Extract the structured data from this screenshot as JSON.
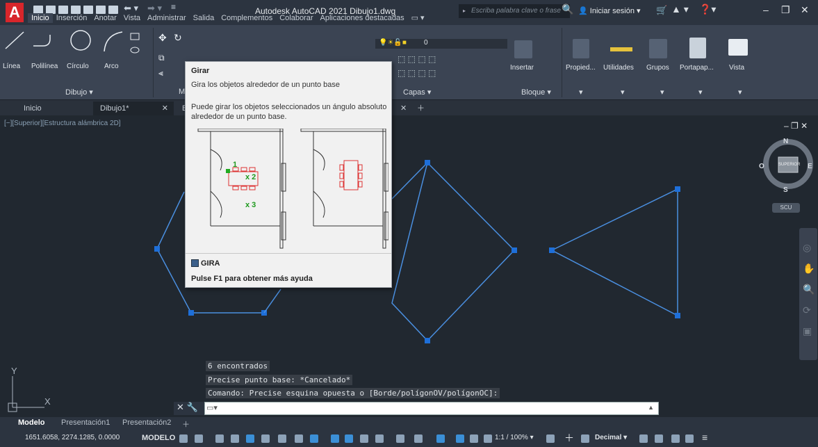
{
  "window": {
    "title": "Autodesk AutoCAD 2021   Dibujo1.dwg",
    "search_placeholder": "Escriba palabra clave o frase",
    "login": "Iniciar sesión",
    "logo": "A"
  },
  "ribbon_tabs": [
    "Inicio",
    "Inserción",
    "Anotar",
    "Vista",
    "Administrar",
    "Salida",
    "Complementos",
    "Colaborar",
    "Aplicaciones destacadas"
  ],
  "ribbon": {
    "draw_tools": [
      "Línea",
      "Polilínea",
      "Círculo",
      "Arco"
    ],
    "draw_panel": "Dibujo",
    "modify_panel_partial": "M",
    "layers_panel": "Capas",
    "layer_value": "0",
    "insert_label": "Insertar",
    "block_panel": "Bloque",
    "big_tools": [
      "Propied...",
      "Utilidades",
      "Grupos",
      "Portapap...",
      "Vista"
    ]
  },
  "file_tabs": [
    "Inicio",
    "Dibujo1*"
  ],
  "file_tab_partial": "B",
  "viewport": {
    "label": "[−][Superior][Estructura alámbrica 2D]",
    "compass": {
      "n": "N",
      "s": "S",
      "e": "E",
      "o": "O",
      "center": "SUPERIOR",
      "scu": "SCU"
    }
  },
  "tooltip": {
    "title": "Girar",
    "desc": "Gira los objetos alrededor de un punto base",
    "long": "Puede girar los objetos seleccionados un ángulo absoluto alrededor de un punto base.",
    "marks": [
      "1",
      "x 2",
      "x 3"
    ],
    "command": "GIRA",
    "help": "Pulse F1 para obtener más ayuda"
  },
  "command_history": [
    "6 encontrados",
    "Precise punto base: *Cancelado*",
    "Comando: Precise esquina opuesta o [Borde/polígonOV/polígonOC]:"
  ],
  "layout_tabs": [
    "Modelo",
    "Presentación1",
    "Presentación2"
  ],
  "status": {
    "coords": "1651.6058, 2274.1285, 0.0000",
    "mode": "MODELO",
    "scale": "1:1 / 100%",
    "units": "Decimal"
  },
  "ucs": {
    "x": "X",
    "y": "Y"
  },
  "colors": {
    "accent": "#3b8fd6",
    "selection": "#1e6fd9",
    "red": "#d8262b"
  }
}
